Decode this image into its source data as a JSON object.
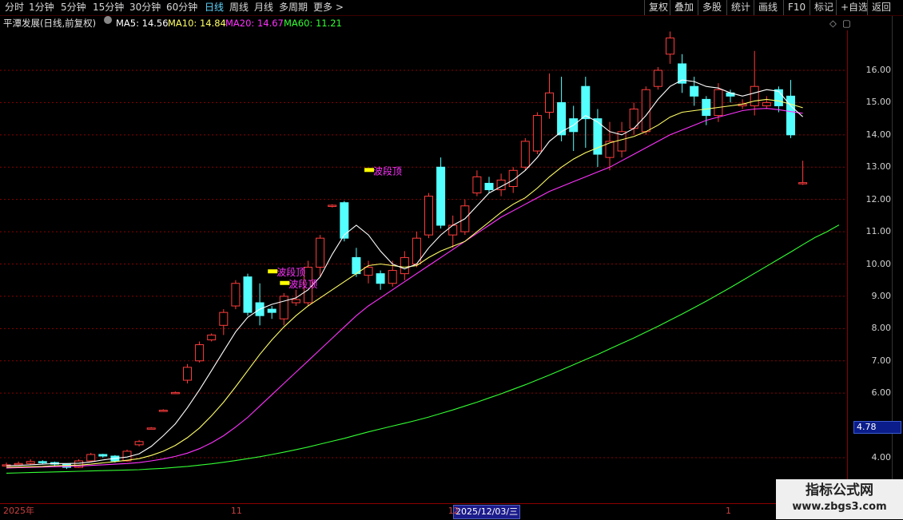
{
  "toolbar": {
    "periods": [
      "分时",
      "1分钟",
      "5分钟",
      "15分钟",
      "30分钟",
      "60分钟",
      "日线",
      "周线",
      "月线",
      "多周期",
      "更多 >"
    ],
    "active_period": "日线",
    "right_buttons": [
      "复权",
      "叠加",
      "多股",
      "统计",
      "画线",
      "F10",
      "标记",
      "+自选",
      "返回"
    ]
  },
  "info": {
    "title": "平潭发展(日线,前复权)",
    "ma5": "MA5: 14.56",
    "ma10": "MA10: 14.84",
    "ma20": "MA20: 14.67",
    "ma60": "MA60: 11.21"
  },
  "colors": {
    "up": "#ff3c3c",
    "down": "#54ffff",
    "ma5": "#ffffff",
    "ma10": "#ffff66",
    "ma20": "#ff33ff",
    "ma60": "#33ff33",
    "grid": "#8b0000",
    "signal_label": "#ff33ff",
    "signal_marker": "#ffff00"
  },
  "chart_data": {
    "type": "candlestick",
    "y_axis_labels": [
      "16.00",
      "15.00",
      "14.00",
      "13.00",
      "12.00",
      "11.00",
      "10.00",
      "9.00",
      "8.00",
      "7.00",
      "6.00",
      "4.00"
    ],
    "y_ticks": [
      16,
      15,
      14,
      13,
      12,
      11,
      10,
      9,
      8,
      7,
      6,
      4
    ],
    "ylim": [
      3.1,
      17.3
    ],
    "current_price_tag": "4.78",
    "x_labels": [
      {
        "text": "2025年",
        "bar": 0
      },
      {
        "text": "11",
        "bar": 19
      },
      {
        "text": "12",
        "bar": 37
      }
    ],
    "x_cursor": "2025/12/03/三",
    "x_label_end": {
      "text": "1",
      "bar": 60
    },
    "signal_text": "波段顶",
    "signals": [
      {
        "bar": 22,
        "price": 9.76
      },
      {
        "bar": 23,
        "price": 9.4
      },
      {
        "bar": 30,
        "price": 12.9
      }
    ],
    "candles": [
      [
        3.75,
        3.78,
        3.85,
        3.73
      ],
      [
        3.78,
        3.82,
        3.88,
        3.75
      ],
      [
        3.82,
        3.88,
        3.95,
        3.78
      ],
      [
        3.88,
        3.85,
        3.92,
        3.8
      ],
      [
        3.85,
        3.8,
        3.88,
        3.72
      ],
      [
        3.8,
        3.7,
        3.82,
        3.65
      ],
      [
        3.7,
        3.9,
        3.95,
        3.68
      ],
      [
        3.9,
        4.1,
        4.15,
        3.88
      ],
      [
        4.1,
        4.05,
        4.12,
        4.0
      ],
      [
        4.05,
        3.9,
        4.08,
        3.85
      ],
      [
        3.9,
        4.2,
        4.25,
        3.88
      ],
      [
        4.4,
        4.5,
        4.55,
        4.35
      ],
      [
        4.9,
        4.92,
        4.95,
        4.88
      ],
      [
        5.45,
        5.47,
        5.5,
        5.42
      ],
      [
        6.0,
        6.02,
        6.05,
        5.98
      ],
      [
        6.4,
        6.8,
        6.9,
        6.3
      ],
      [
        7.0,
        7.5,
        7.6,
        6.95
      ],
      [
        7.65,
        7.8,
        7.85,
        7.6
      ],
      [
        8.1,
        8.5,
        8.6,
        7.8
      ],
      [
        8.7,
        9.4,
        9.5,
        8.6
      ],
      [
        9.6,
        8.5,
        9.7,
        8.4
      ],
      [
        8.8,
        8.4,
        9.4,
        8.1
      ],
      [
        8.6,
        8.5,
        8.7,
        8.3
      ],
      [
        8.3,
        9.0,
        9.1,
        8.1
      ],
      [
        8.8,
        8.9,
        9.2,
        8.7
      ],
      [
        8.8,
        9.9,
        10.1,
        8.7
      ],
      [
        9.9,
        10.8,
        10.9,
        9.6
      ],
      [
        11.8,
        11.82,
        11.85,
        11.75
      ],
      [
        11.9,
        10.8,
        11.95,
        10.7
      ],
      [
        10.2,
        9.7,
        10.5,
        9.6
      ],
      [
        9.65,
        9.9,
        10.1,
        9.4
      ],
      [
        9.7,
        9.4,
        9.8,
        9.2
      ],
      [
        9.4,
        9.8,
        10.1,
        9.3
      ],
      [
        9.7,
        10.2,
        10.4,
        9.5
      ],
      [
        10.0,
        10.8,
        11.0,
        9.9
      ],
      [
        10.9,
        12.1,
        12.2,
        10.8
      ],
      [
        13.0,
        11.2,
        13.3,
        11.1
      ],
      [
        10.9,
        11.2,
        11.5,
        10.5
      ],
      [
        11.0,
        11.8,
        12.0,
        10.9
      ],
      [
        12.2,
        12.7,
        12.9,
        12.1
      ],
      [
        12.5,
        12.3,
        12.7,
        12.2
      ],
      [
        12.3,
        12.6,
        12.8,
        12.1
      ],
      [
        12.4,
        12.9,
        13.0,
        12.2
      ],
      [
        13.0,
        13.8,
        13.9,
        12.9
      ],
      [
        13.5,
        14.6,
        14.7,
        13.4
      ],
      [
        14.7,
        15.3,
        15.9,
        14.5
      ],
      [
        15.0,
        14.0,
        15.8,
        13.8
      ],
      [
        14.5,
        14.1,
        14.9,
        13.5
      ],
      [
        15.5,
        14.5,
        15.8,
        13.6
      ],
      [
        14.5,
        13.4,
        14.8,
        13.0
      ],
      [
        13.3,
        13.8,
        14.4,
        12.9
      ],
      [
        13.5,
        14.1,
        14.4,
        13.3
      ],
      [
        14.2,
        14.8,
        15.0,
        14.0
      ],
      [
        14.1,
        15.4,
        15.5,
        14.0
      ],
      [
        15.5,
        16.0,
        16.1,
        15.4
      ],
      [
        16.5,
        17.0,
        17.2,
        16.2
      ],
      [
        16.2,
        15.6,
        16.5,
        15.3
      ],
      [
        15.5,
        15.2,
        15.8,
        14.9
      ],
      [
        15.1,
        14.6,
        15.2,
        14.3
      ],
      [
        14.6,
        15.4,
        15.6,
        14.4
      ],
      [
        15.3,
        15.2,
        15.4,
        15.0
      ],
      [
        14.9,
        14.95,
        15.1,
        14.8
      ],
      [
        14.9,
        15.5,
        16.6,
        14.6
      ],
      [
        14.9,
        15.0,
        15.2,
        14.8
      ],
      [
        15.4,
        14.9,
        15.5,
        14.7
      ],
      [
        15.2,
        14.0,
        15.7,
        13.9
      ],
      [
        12.5,
        12.52,
        13.2,
        12.45
      ]
    ],
    "ma5": [
      3.75,
      3.76,
      3.78,
      3.8,
      3.82,
      3.82,
      3.83,
      3.87,
      3.93,
      3.98,
      4.02,
      4.12,
      4.35,
      4.68,
      5.05,
      5.55,
      6.1,
      6.7,
      7.3,
      7.9,
      8.35,
      8.6,
      8.75,
      8.85,
      8.95,
      9.2,
      9.6,
      10.3,
      10.9,
      11.2,
      10.9,
      10.4,
      10.0,
      9.85,
      10.0,
      10.5,
      10.9,
      11.2,
      11.4,
      11.8,
      12.2,
      12.4,
      12.6,
      12.9,
      13.3,
      13.8,
      14.1,
      14.3,
      14.6,
      14.4,
      14.1,
      14.0,
      14.2,
      14.6,
      15.1,
      15.5,
      15.7,
      15.65,
      15.5,
      15.45,
      15.3,
      15.2,
      15.3,
      15.4,
      15.35,
      14.9,
      14.56
    ],
    "ma10": [
      3.7,
      3.71,
      3.72,
      3.73,
      3.75,
      3.76,
      3.77,
      3.8,
      3.84,
      3.88,
      3.92,
      3.97,
      4.07,
      4.2,
      4.38,
      4.62,
      4.92,
      5.3,
      5.72,
      6.2,
      6.7,
      7.2,
      7.65,
      8.05,
      8.4,
      8.7,
      8.95,
      9.2,
      9.45,
      9.7,
      9.95,
      10.0,
      9.95,
      9.9,
      9.95,
      10.2,
      10.4,
      10.55,
      10.7,
      11.0,
      11.3,
      11.6,
      11.85,
      12.05,
      12.35,
      12.7,
      13.0,
      13.25,
      13.45,
      13.6,
      13.75,
      13.85,
      13.95,
      14.1,
      14.3,
      14.55,
      14.7,
      14.75,
      14.8,
      14.85,
      14.9,
      14.95,
      15.05,
      15.1,
      15.05,
      14.95,
      14.84
    ],
    "ma20": [
      3.68,
      3.69,
      3.7,
      3.71,
      3.72,
      3.73,
      3.74,
      3.76,
      3.78,
      3.8,
      3.82,
      3.85,
      3.9,
      3.96,
      4.04,
      4.14,
      4.28,
      4.46,
      4.68,
      4.95,
      5.25,
      5.6,
      5.95,
      6.3,
      6.65,
      7.0,
      7.35,
      7.7,
      8.05,
      8.4,
      8.7,
      8.95,
      9.2,
      9.45,
      9.7,
      9.95,
      10.2,
      10.45,
      10.7,
      10.95,
      11.2,
      11.45,
      11.65,
      11.85,
      12.05,
      12.25,
      12.4,
      12.55,
      12.7,
      12.85,
      13.0,
      13.2,
      13.4,
      13.6,
      13.8,
      14.0,
      14.15,
      14.3,
      14.45,
      14.55,
      14.65,
      14.75,
      14.8,
      14.82,
      14.78,
      14.72,
      14.67
    ],
    "ma60": [
      3.52,
      3.53,
      3.54,
      3.55,
      3.56,
      3.57,
      3.58,
      3.59,
      3.6,
      3.61,
      3.62,
      3.63,
      3.65,
      3.67,
      3.7,
      3.73,
      3.77,
      3.81,
      3.86,
      3.91,
      3.97,
      4.03,
      4.1,
      4.17,
      4.25,
      4.33,
      4.42,
      4.51,
      4.6,
      4.7,
      4.8,
      4.89,
      4.98,
      5.07,
      5.16,
      5.26,
      5.37,
      5.48,
      5.6,
      5.72,
      5.85,
      5.98,
      6.12,
      6.26,
      6.41,
      6.56,
      6.72,
      6.88,
      7.04,
      7.2,
      7.37,
      7.54,
      7.71,
      7.89,
      8.07,
      8.26,
      8.45,
      8.65,
      8.85,
      9.06,
      9.27,
      9.49,
      9.71,
      9.93,
      10.15,
      10.37,
      10.6,
      10.82,
      11.0,
      11.21
    ]
  },
  "watermark": {
    "title": "指标公式网",
    "url": "www.zbgs3.com"
  }
}
